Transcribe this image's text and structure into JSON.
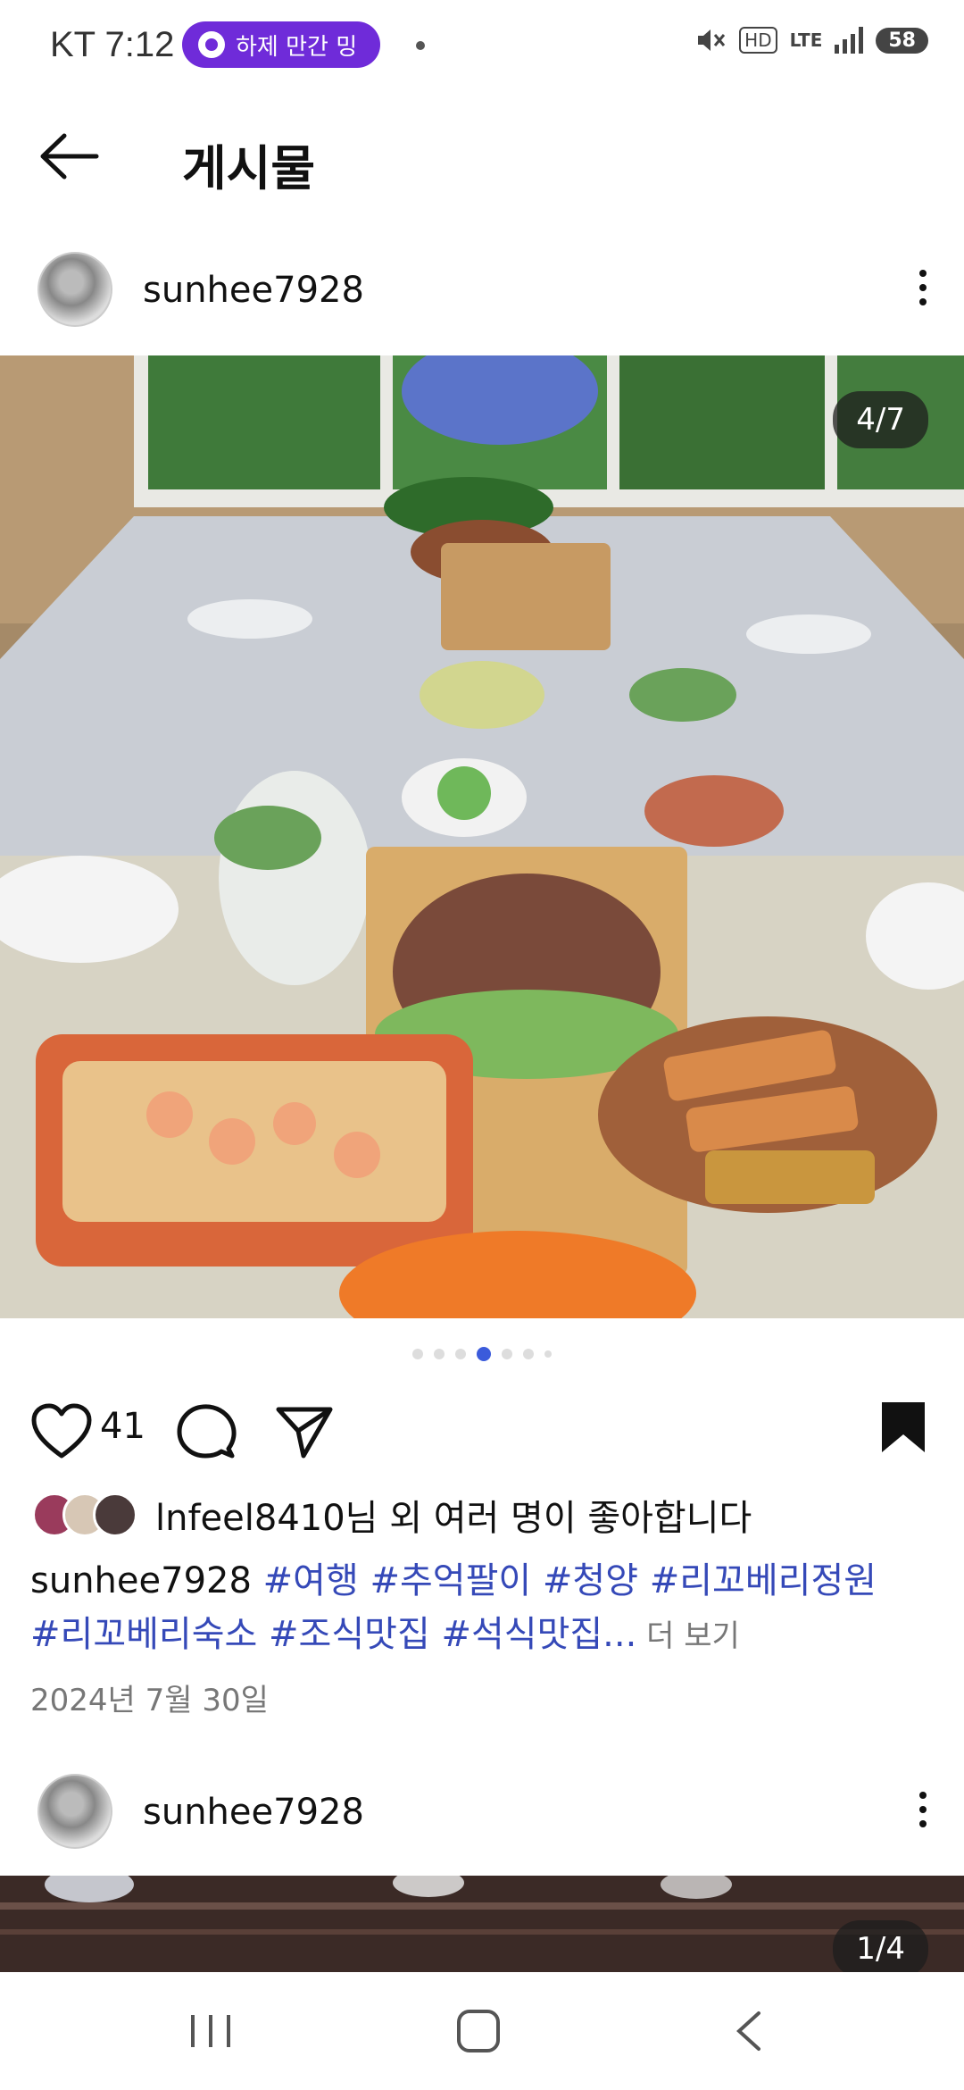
{
  "status_bar": {
    "carrier_time": "KT 7:12",
    "pill_text": "하제 만간 밍",
    "network": "LTE",
    "hd": "HD",
    "battery": "58"
  },
  "header": {
    "title": "게시물"
  },
  "post": {
    "username": "sunhee7928",
    "image_counter": "4/7",
    "carousel_index": 4,
    "carousel_total": 7,
    "like_count": "41",
    "likes_text": "lnfeel8410님 외 여러 명이 좋아합니다",
    "caption_user": "sunhee7928",
    "caption_tags_line1": " #여행 #추억팔이 #청양 #리꼬베리정원",
    "caption_tags_line2": "#리꼬베리숙소 #조식맛집 #석식맛집...",
    "more_label": " 더 보기",
    "date": "2024년 7월 30일"
  },
  "next_post": {
    "username": "sunhee7928",
    "image_counter": "1/4"
  },
  "colors": {
    "accent_purple": "#6f2bd9",
    "hashtag_blue": "#3549b8",
    "dot_active": "#3b5bdb"
  },
  "icons": [
    "back-arrow-icon",
    "more-vertical-icon",
    "heart-icon",
    "comment-icon",
    "share-icon",
    "bookmark-icon",
    "recent-apps-icon",
    "home-icon",
    "back-nav-icon"
  ]
}
